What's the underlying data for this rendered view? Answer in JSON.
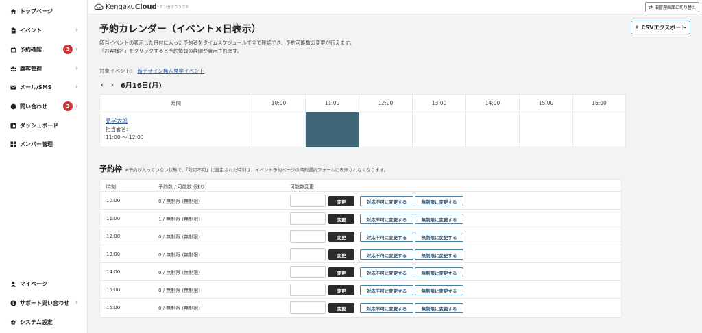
{
  "sidebar": {
    "items": [
      {
        "label": "トップページ",
        "icon": "home-icon"
      },
      {
        "label": "イベント",
        "icon": "document-icon",
        "chevron": "›"
      },
      {
        "label": "予約確認",
        "icon": "calendar-icon",
        "badge": "3",
        "chevron": "›"
      },
      {
        "label": "顧客管理",
        "icon": "users-icon",
        "chevron": "›"
      },
      {
        "label": "メール/SMS",
        "icon": "mail-icon",
        "chevron": "›"
      },
      {
        "label": "問い合わせ",
        "icon": "chat-icon",
        "badge": "3",
        "chevron": "›"
      },
      {
        "label": "ダッシュボード",
        "icon": "chart-icon"
      },
      {
        "label": "メンバー管理",
        "icon": "grid-icon"
      }
    ],
    "bottom_items": [
      {
        "label": "マイページ",
        "icon": "user-icon"
      },
      {
        "label": "サポート問い合わせ",
        "icon": "help-icon",
        "chevron": "›"
      },
      {
        "label": "システム設定",
        "icon": "gear-icon"
      }
    ]
  },
  "topbar": {
    "logo_prefix": "Kengaku",
    "logo_bold": "Cloud",
    "logo_sub": "ケンガククラウド",
    "switch_label": "旧管理画面に切り替え"
  },
  "main": {
    "title": "予約カレンダー（イベント×日表示）",
    "desc_line1": "該当イベントの表示した日付に入った予約者をタイムスケジュールで全て確認でき、予約可能数の変更が行えます。",
    "desc_line2": "「お客様名」をクリックすると予約情報の詳細が表示されます。",
    "csv_label": "CSVエクスポート",
    "event_prefix": "対象イベント：",
    "event_name": "新デザイン無人見学イベント",
    "date_prev": "‹",
    "date_next": "›",
    "date_label": "6月16日(月)"
  },
  "timeline": {
    "header_label": "時間",
    "hours": [
      "10:00",
      "11:00",
      "12:00",
      "13:00",
      "14:00",
      "15:00",
      "16:00"
    ],
    "booked_hour": "11:00",
    "guest_name": "見学太郎",
    "guest_manager": "担当者名:",
    "guest_time": "11:00 〜 12:00"
  },
  "slots": {
    "title": "予約枠",
    "note": "※予約が入っていない状態で、「対応不可」に設定された時刻は、イベント予約ページの時刻選択フォームに表示されなくなります。",
    "col_time": "時刻",
    "col_count": "予約数 / 可能数 (残り)",
    "col_change": "可能数変更",
    "change_label": "変更",
    "unavailable_label": "対応不可に変更する",
    "unlimited_label": "無制限に変更する",
    "rows": [
      {
        "time": "10:00",
        "count": "0 / 無制限 (無制限)"
      },
      {
        "time": "11:00",
        "count": "1 / 無制限 (無制限)"
      },
      {
        "time": "12:00",
        "count": "0 / 無制限 (無制限)"
      },
      {
        "time": "13:00",
        "count": "0 / 無制限 (無制限)"
      },
      {
        "time": "14:00",
        "count": "0 / 無制限 (無制限)"
      },
      {
        "time": "15:00",
        "count": "0 / 無制限 (無制限)"
      },
      {
        "time": "16:00",
        "count": "0 / 無制限 (無制限)"
      }
    ]
  },
  "colors": {
    "booked": "#3f6777",
    "badge": "#c8373c",
    "link": "#2e5d9e"
  }
}
